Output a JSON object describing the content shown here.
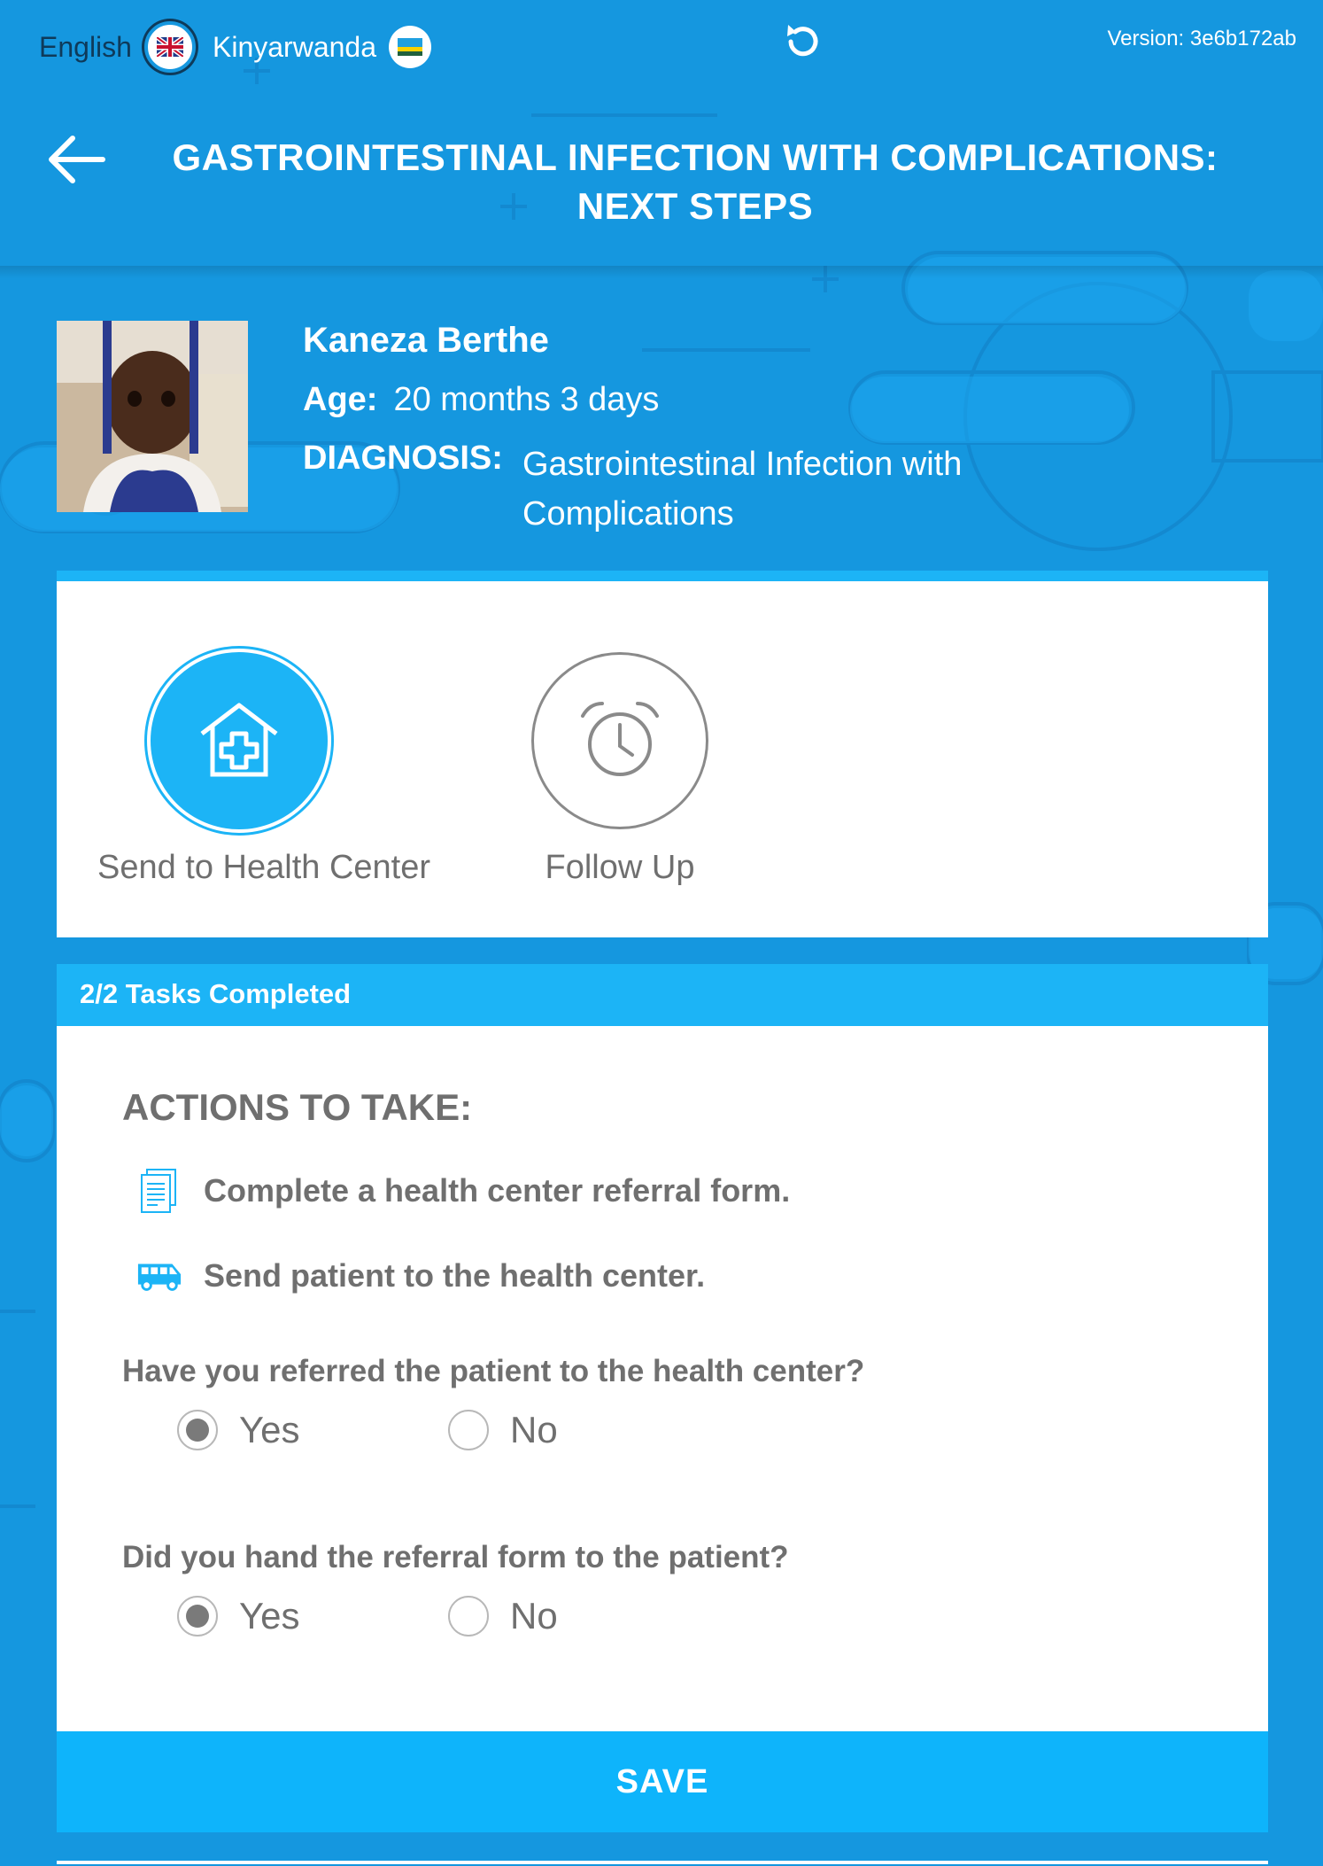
{
  "languages": [
    {
      "label": "English",
      "flag": "uk-flag",
      "active": true
    },
    {
      "label": "Kinyarwanda",
      "flag": "rwanda-flag",
      "active": false
    }
  ],
  "version": "Version: 3e6b172ab",
  "header": {
    "title": "GASTROINTESTINAL INFECTION WITH COMPLICATIONS: NEXT STEPS"
  },
  "patient": {
    "name": "Kaneza Berthe",
    "age_label": "Age:",
    "age_value": "20 months 3 days",
    "diagnosis_label": "DIAGNOSIS:",
    "diagnosis_value": "Gastrointestinal Infection with Complications"
  },
  "activities": [
    {
      "label": "Send to Health Center",
      "icon": "health-center-icon",
      "active": true
    },
    {
      "label": "Follow Up",
      "icon": "alarm-clock-icon",
      "active": false
    }
  ],
  "tasks_status": "2/2 Tasks Completed",
  "form": {
    "actions_title": "ACTIONS TO TAKE:",
    "actions": [
      {
        "icon": "document-icon",
        "text": "Complete a health center referral form."
      },
      {
        "icon": "bus-icon",
        "text": "Send patient to the health center."
      }
    ],
    "questions": [
      {
        "text": "Have you referred the patient to the health center?",
        "options": [
          "Yes",
          "No"
        ],
        "selected": "Yes"
      },
      {
        "text": "Did you hand the referral form to the patient?",
        "options": [
          "Yes",
          "No"
        ],
        "selected": "Yes"
      }
    ],
    "save_label": "SAVE"
  },
  "colors": {
    "background": "#1597df",
    "accent": "#1cb4f6",
    "save": "#0eb4fb",
    "text_gray": "#6f6f6f"
  }
}
